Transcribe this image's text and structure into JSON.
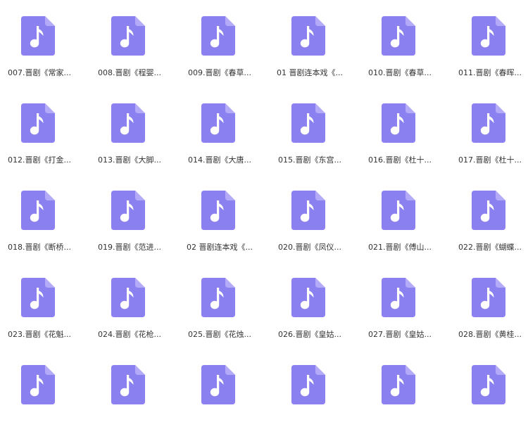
{
  "colors": {
    "icon_main": "#8a80f0",
    "icon_fold": "#b3abf7",
    "note": "#ffffff",
    "label_text": "#333333",
    "background": "#ffffff"
  },
  "icon_name": "music-file-icon",
  "files": [
    {
      "name": "007.晋剧《常家..."
    },
    {
      "name": "008.晋剧《程婴..."
    },
    {
      "name": "009.晋剧《春草..."
    },
    {
      "name": "01 晋剧连本戏《..."
    },
    {
      "name": "010.晋剧《春草..."
    },
    {
      "name": "011.晋剧《春晖..."
    },
    {
      "name": "012.晋剧《打金..."
    },
    {
      "name": "013.晋剧《大脚..."
    },
    {
      "name": "014.晋剧《大唐..."
    },
    {
      "name": "015.晋剧《东宫..."
    },
    {
      "name": "016.晋剧《杜十..."
    },
    {
      "name": "017.晋剧《杜十..."
    },
    {
      "name": "018.晋剧《断桥..."
    },
    {
      "name": "019.晋剧《范进..."
    },
    {
      "name": "02 晋剧连本戏《..."
    },
    {
      "name": "020.晋剧《凤仪..."
    },
    {
      "name": "021.晋剧《傅山..."
    },
    {
      "name": "022.晋剧《蝴蝶..."
    },
    {
      "name": "023.晋剧《花魁..."
    },
    {
      "name": "024.晋剧《花枪..."
    },
    {
      "name": "025.晋剧《花烛..."
    },
    {
      "name": "026.晋剧《皇姑..."
    },
    {
      "name": "027.晋剧《皇姑..."
    },
    {
      "name": "028.晋剧《黄桂..."
    },
    {
      "name": ""
    },
    {
      "name": ""
    },
    {
      "name": ""
    },
    {
      "name": ""
    },
    {
      "name": ""
    },
    {
      "name": ""
    }
  ]
}
